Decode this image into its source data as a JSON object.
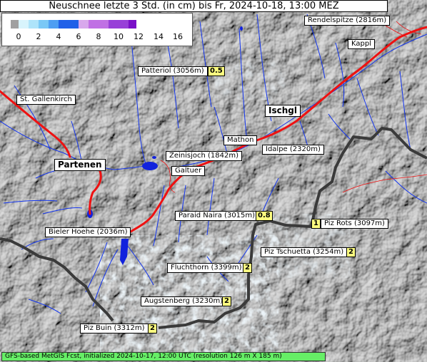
{
  "title": "Neuschnee letzte 3 Std. (in cm) bis Fr, 2024-10-18, 13:00 MEZ",
  "footer": "GFS-based MetGIS Fcst, initialized 2024-10-17, 12:00 UTC  (resolution 126 m X 185 m)",
  "legend": {
    "ticks": [
      "0",
      "2",
      "4",
      "6",
      "8",
      "10",
      "12",
      "14",
      "16"
    ],
    "colors": [
      "#a0a0a0",
      "#d8f4fc",
      "#aee4fa",
      "#7ac8f6",
      "#4e9ef2",
      "#2060e8",
      "#d8a8ec",
      "#c070e4",
      "#9840d8",
      "#7a10c8"
    ]
  },
  "places": {
    "rendelspitze": "Rendelspitze (2816m)",
    "kappl": "Kappl",
    "patteriol": "Patteriol (3056m)",
    "st_gallenkirch": "St. Gallenkirch",
    "ischgl": "Ischgl",
    "mathon": "Mathon",
    "idalpe": "Idalpe (2320m)",
    "zeinisjoch": "Zeinisjoch (1842m)",
    "partenen": "Partenen",
    "galtuer": "Galtuer",
    "paraid_naira": "Paraid Naira (3015m)",
    "piz_rots": "Piz Rots (3097m)",
    "bieler_hoehe": "Bieler Hoehe (2036m)",
    "piz_tschuetta": "Piz Tschuetta (3254m)",
    "fluchthorn": "Fluchthorn (3399m)",
    "augstenberg": "Augstenberg (3230m)",
    "piz_buin": "Piz Buin (3312m)"
  },
  "values": {
    "patteriol": "0.5",
    "paraid_naira": "0.8",
    "piz_rots": "1",
    "piz_tschuetta": "2",
    "fluchthorn": "2",
    "augstenberg": "2",
    "piz_buin": "2"
  }
}
